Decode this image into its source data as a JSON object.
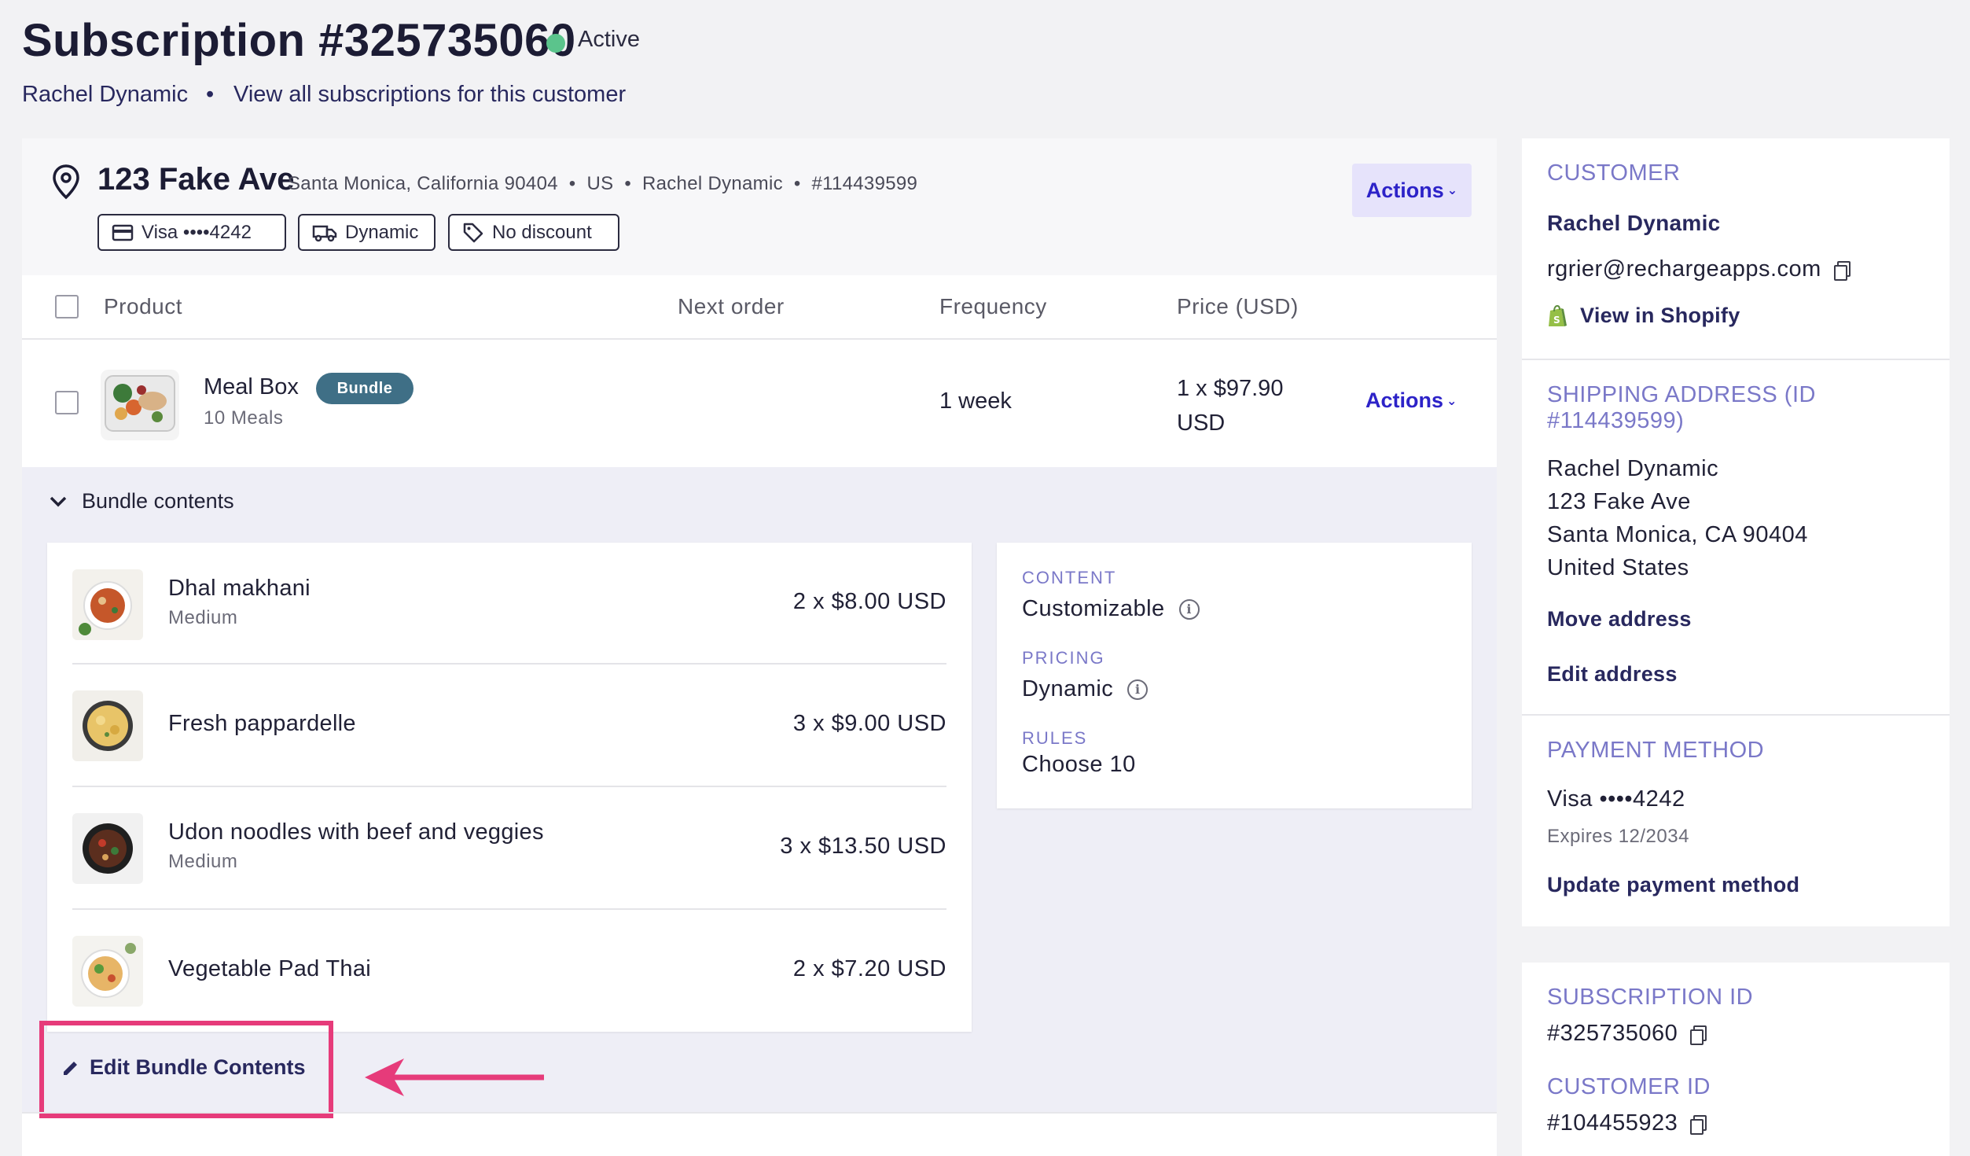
{
  "header": {
    "title": "Subscription #325735060",
    "status": "Active",
    "status_color": "#5bc48c",
    "customer_name": "Rachel Dynamic",
    "separator": "•",
    "view_all_link": "View all subscriptions for this customer"
  },
  "address_header": {
    "street": "123 Fake Ave",
    "meta": "Santa Monica, California 90404  •  US  •  Rachel Dynamic  •  #114439599",
    "chips": {
      "payment": "Visa ••••4242",
      "shipping": "Dynamic",
      "discount": "No discount"
    },
    "actions_label": "Actions"
  },
  "table": {
    "columns": {
      "product": "Product",
      "next_order": "Next order",
      "frequency": "Frequency",
      "price": "Price (USD)"
    },
    "row": {
      "name": "Meal Box",
      "badge": "Bundle",
      "subtitle": "10 Meals",
      "frequency": "1 week",
      "price_line1": "1 x $97.90",
      "price_line2": "USD",
      "actions_label": "Actions"
    }
  },
  "bundle": {
    "toggle_label": "Bundle contents",
    "items": [
      {
        "name": "Dhal makhani",
        "subtitle": "Medium",
        "qty": "2 x $8.00 USD"
      },
      {
        "name": "Fresh pappardelle",
        "subtitle": "",
        "qty": "3 x $9.00 USD"
      },
      {
        "name": "Udon noodles with beef and veggies",
        "subtitle": "Medium",
        "qty": "3 x $13.50 USD"
      },
      {
        "name": "Vegetable Pad Thai",
        "subtitle": "",
        "qty": "2 x $7.20 USD"
      }
    ],
    "info": {
      "content_label": "CONTENT",
      "content_value": "Customizable",
      "pricing_label": "PRICING",
      "pricing_value": "Dynamic",
      "rules_label": "RULES",
      "rules_value": "Choose 10"
    },
    "edit_button": "Edit Bundle Contents",
    "highlight_color": "#e63b7a"
  },
  "sidebar": {
    "customer": {
      "title": "CUSTOMER",
      "name": "Rachel Dynamic",
      "email": "rgrier@rechargeapps.com",
      "shopify_link": "View in Shopify"
    },
    "shipping": {
      "title": "SHIPPING ADDRESS (ID #114439599)",
      "lines": [
        "Rachel Dynamic",
        "123 Fake Ave",
        "Santa Monica, CA 90404",
        "United States"
      ],
      "move_link": "Move address",
      "edit_link": "Edit address"
    },
    "payment": {
      "title": "PAYMENT METHOD",
      "card": "Visa ••••4242",
      "expires": "Expires 12/2034",
      "update_link": "Update payment method"
    },
    "ids": {
      "subscription_title": "SUBSCRIPTION ID",
      "subscription_id": "#325735060",
      "customer_title": "CUSTOMER ID",
      "customer_id": "#104455923"
    }
  },
  "colors": {
    "accent": "#2d23c8",
    "navy": "#28285e",
    "label_purple": "#7a78c8",
    "badge": "#3f6f86",
    "page_bg": "#f2f2f4"
  }
}
